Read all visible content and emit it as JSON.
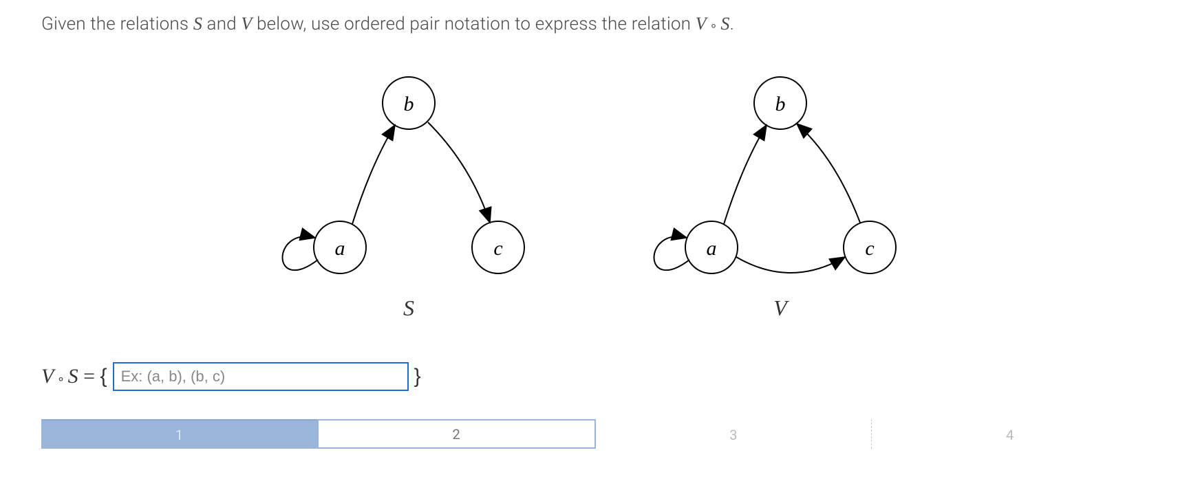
{
  "question": {
    "prefix": "Given the relations ",
    "rel1": "S",
    "mid1": " and ",
    "rel2": "V",
    "mid2": " below, use ordered pair notation to express the relation ",
    "comp_v": "V",
    "comp_circ": " ∘ ",
    "comp_s": "S",
    "suffix": "."
  },
  "diagrams": {
    "S": {
      "label": "S",
      "nodes": {
        "a": "a",
        "b": "b",
        "c": "c"
      },
      "edges": [
        "(a,a)",
        "(a,b)",
        "(b,c)"
      ]
    },
    "V": {
      "label": "V",
      "nodes": {
        "a": "a",
        "b": "b",
        "c": "c"
      },
      "edges": [
        "(a,a)",
        "(a,b)",
        "(a,c)",
        "(c,b)"
      ]
    }
  },
  "answer": {
    "lhs_v": "V",
    "lhs_circ": " ∘ ",
    "lhs_s": "S",
    "equals": " = ",
    "open_brace": "{",
    "close_brace": "}",
    "placeholder": "Ex: (a, b), (b, c)",
    "value": ""
  },
  "steps": {
    "items": [
      "1",
      "2",
      "3",
      "4"
    ],
    "current": 2
  }
}
